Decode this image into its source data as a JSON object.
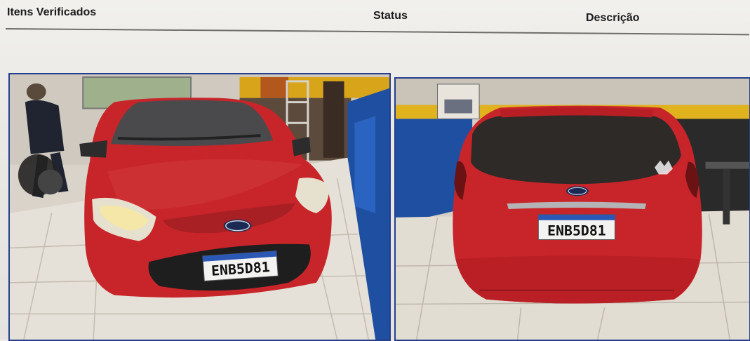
{
  "table_header": {
    "itens_verificados": "Itens Verificados",
    "status": "Status",
    "descricao": "Descrição"
  },
  "photos": {
    "front": {
      "plate": "ENB5D81",
      "brand": "Ford"
    },
    "rear": {
      "plate": "ENB5D81",
      "brand": "Ford"
    }
  },
  "colors": {
    "car_body": "#c8252a",
    "frame_border": "#263f8c",
    "shop_wall_yellow": "#e3b51e",
    "banner_blue": "#1f4fa0"
  }
}
